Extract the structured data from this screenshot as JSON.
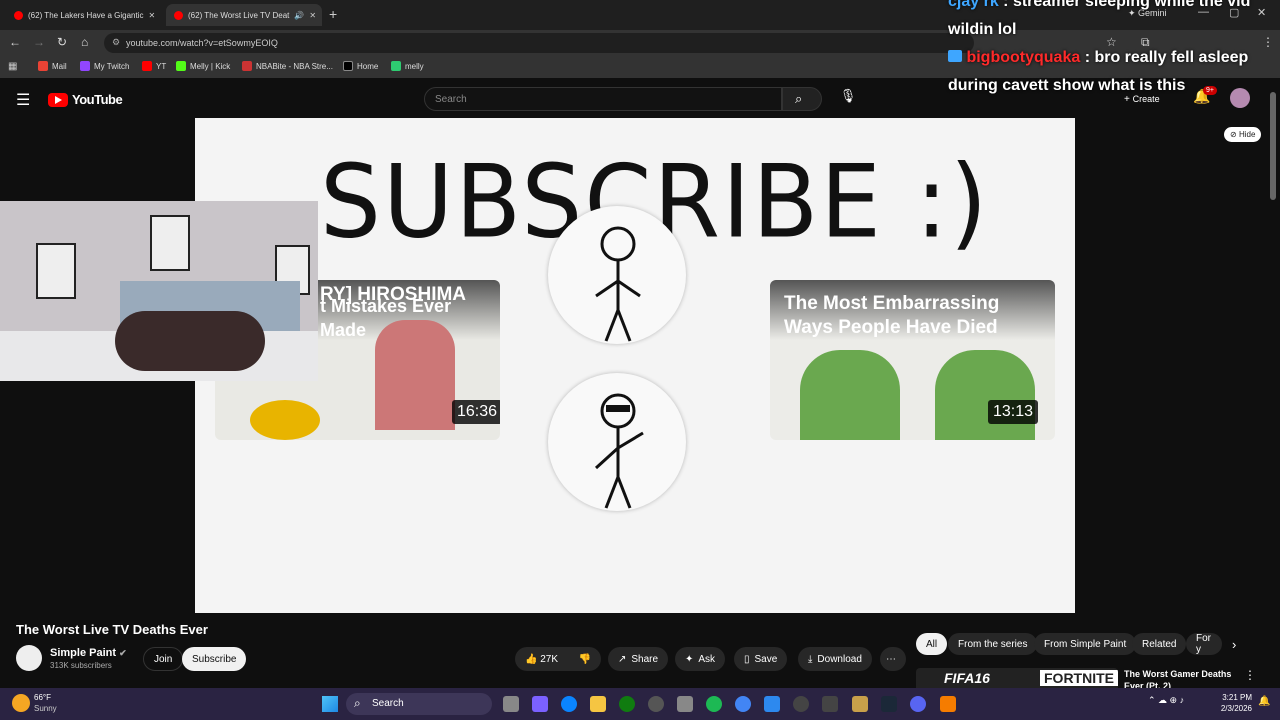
{
  "browser": {
    "tabs": [
      {
        "label": "(62) The Lakers Have a Gigantic"
      },
      {
        "label": "(62) The Worst Live TV Deat"
      }
    ],
    "url": "youtube.com/watch?v=etSowmyEOIQ",
    "bookmarks": [
      "Mail",
      "My Twitch",
      "YT",
      "Melly | Kick",
      "NBABite - NBA Stre...",
      "Home",
      "melly"
    ],
    "gemini_label": "Gemini"
  },
  "youtube": {
    "logo": "YouTube",
    "search_placeholder": "Search",
    "create_label": "Create",
    "notif_badge": "9+",
    "hide_label": "Hide"
  },
  "video": {
    "end_card_text": "SUBSCRIBE :)",
    "left_card_title": "t Mistakes Ever Made",
    "left_card_overlay": "RY]   HIROSHIMA",
    "left_card_duration": "16:36",
    "right_card_title": "The Most Embarrassing Ways People Have Died",
    "right_card_duration": "13:13",
    "title": "The Worst Live TV Deaths Ever",
    "channel": "Simple Paint",
    "subscribers": "313K subscribers",
    "join_label": "Join",
    "subscribe_label": "Subscribe",
    "likes": "27K",
    "share_label": "Share",
    "ask_label": "Ask",
    "save_label": "Save",
    "download_label": "Download"
  },
  "chips": [
    "All",
    "From the series",
    "From Simple Paint",
    "Related",
    "For y"
  ],
  "next_video": {
    "title": "The Worst Gamer Deaths Ever (Pt. 2)",
    "thumb_left": "FIFA16",
    "thumb_right": "FORTNITE"
  },
  "chat": {
    "line1_user": "cjay rk",
    "line1_text": ": streamer sleeping while the vid wildin lol",
    "line2_user": "bigbootyquaka",
    "line2_text": ": bro really fell asleep during cavett show what is this",
    "user1_color": "#3ea6ff",
    "user2_color": "#ff2a2a"
  },
  "taskbar": {
    "weather_temp": "66°F",
    "weather_desc": "Sunny",
    "search_label": "Search",
    "time": "3:21 PM",
    "date": "2/3/2026"
  }
}
